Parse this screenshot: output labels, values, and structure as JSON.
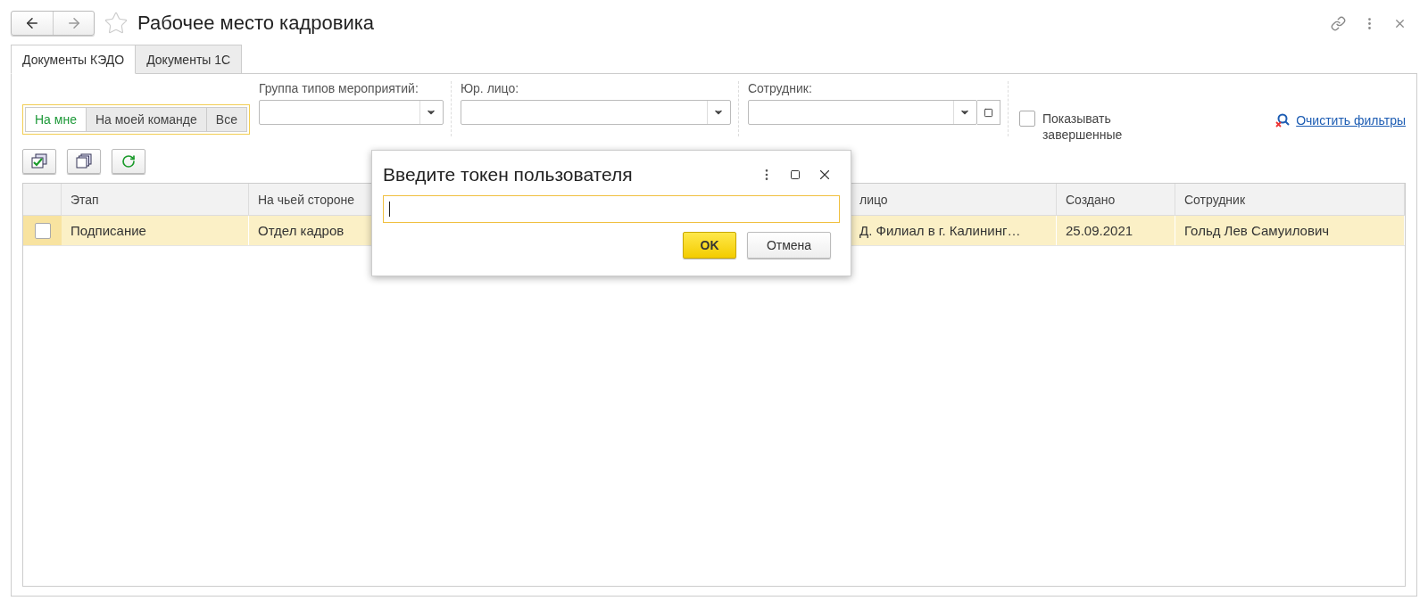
{
  "window": {
    "title": "Рабочее место кадровика"
  },
  "tabs": [
    {
      "label": "Документы КЭДО",
      "selected": true
    },
    {
      "label": "Документы 1С",
      "selected": false
    }
  ],
  "assignee_filter": [
    {
      "label": "На мне",
      "selected": true
    },
    {
      "label": "На моей команде",
      "selected": false
    },
    {
      "label": "Все",
      "selected": false
    }
  ],
  "filters": [
    {
      "label": "Группа типов мероприятий:",
      "kind": "select"
    },
    {
      "label": "Юр. лицо:",
      "kind": "select"
    },
    {
      "label": "Сотрудник:",
      "kind": "select-open"
    }
  ],
  "show_completed": {
    "label": "Показывать завершенные",
    "checked": false
  },
  "clear_filters": "Очистить фильтры",
  "table": {
    "columns": [
      "Этап",
      "На чьей стороне",
      "лицо",
      "Создано",
      "Сотрудник"
    ],
    "rows": [
      {
        "checked": false,
        "selected": true,
        "cells": [
          "Подписание",
          "Отдел кадров",
          "Д. Филиал в г. Калининг…",
          "25.09.2021",
          "Гольд Лев Самуилович"
        ]
      }
    ]
  },
  "dialog": {
    "title": "Введите токен пользователя",
    "focused": true,
    "buttons": [
      {
        "label": "OK",
        "kind": "primary"
      },
      {
        "label": "Отмена",
        "kind": "secondary"
      }
    ]
  }
}
